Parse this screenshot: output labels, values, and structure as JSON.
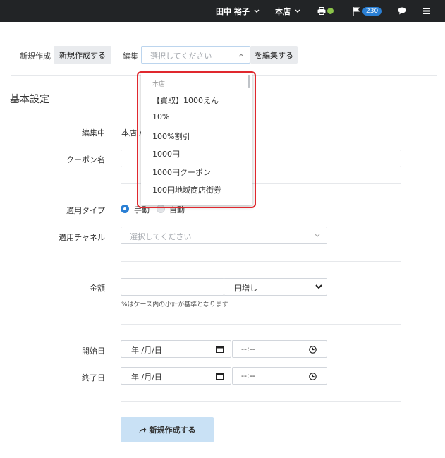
{
  "topbar": {
    "user_name": "田中 裕子",
    "store_name": "本店",
    "caret": "⌄",
    "notification_count": "230",
    "status_color": "#8bc34a"
  },
  "toolbar": {
    "new_label": "新規作成",
    "new_button": "新規作成する",
    "edit_label": "編集",
    "select_placeholder": "選択してください",
    "edit_button": "を編集する"
  },
  "dropdown": {
    "group_label": "本店",
    "items": [
      "【買取】1000えん",
      "10%",
      "100%割引",
      "1000円",
      "1000円クーポン",
      "100円地域商店街券"
    ]
  },
  "section": {
    "title": "基本設定"
  },
  "form": {
    "editing_label": "編集中",
    "editing_value": "本店 /",
    "coupon_name_label": "クーポン名",
    "apply_type_label": "適用タイプ",
    "apply_type_manual": "手動",
    "apply_type_auto": "自動",
    "channel_label": "適用チャネル",
    "channel_placeholder": "選択してください",
    "amount_label": "金額",
    "amount_unit": "円増し",
    "amount_note": "%はケース内の小計が基準となります",
    "start_label": "開始日",
    "end_label": "終了日",
    "date_placeholder": "年 /月/日",
    "time_placeholder": "--:--",
    "submit_label": "新規作成する"
  }
}
